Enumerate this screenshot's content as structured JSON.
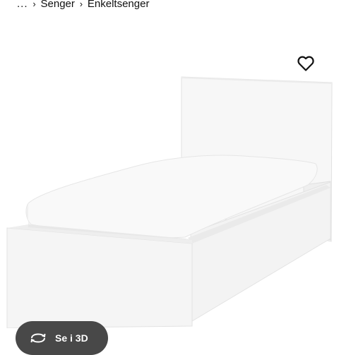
{
  "breadcrumb": {
    "ellipsis": "...",
    "separator": "›",
    "items": [
      "Senger",
      "Enkeltsenger"
    ]
  },
  "icons": {
    "favorite": "heart-outline-icon",
    "view_3d": "rotate-3d-icon"
  },
  "view3d_button": {
    "label": "Se i 3D"
  },
  "colors": {
    "text": "#111111",
    "button_bg": "#484848",
    "button_text": "#ffffff"
  }
}
